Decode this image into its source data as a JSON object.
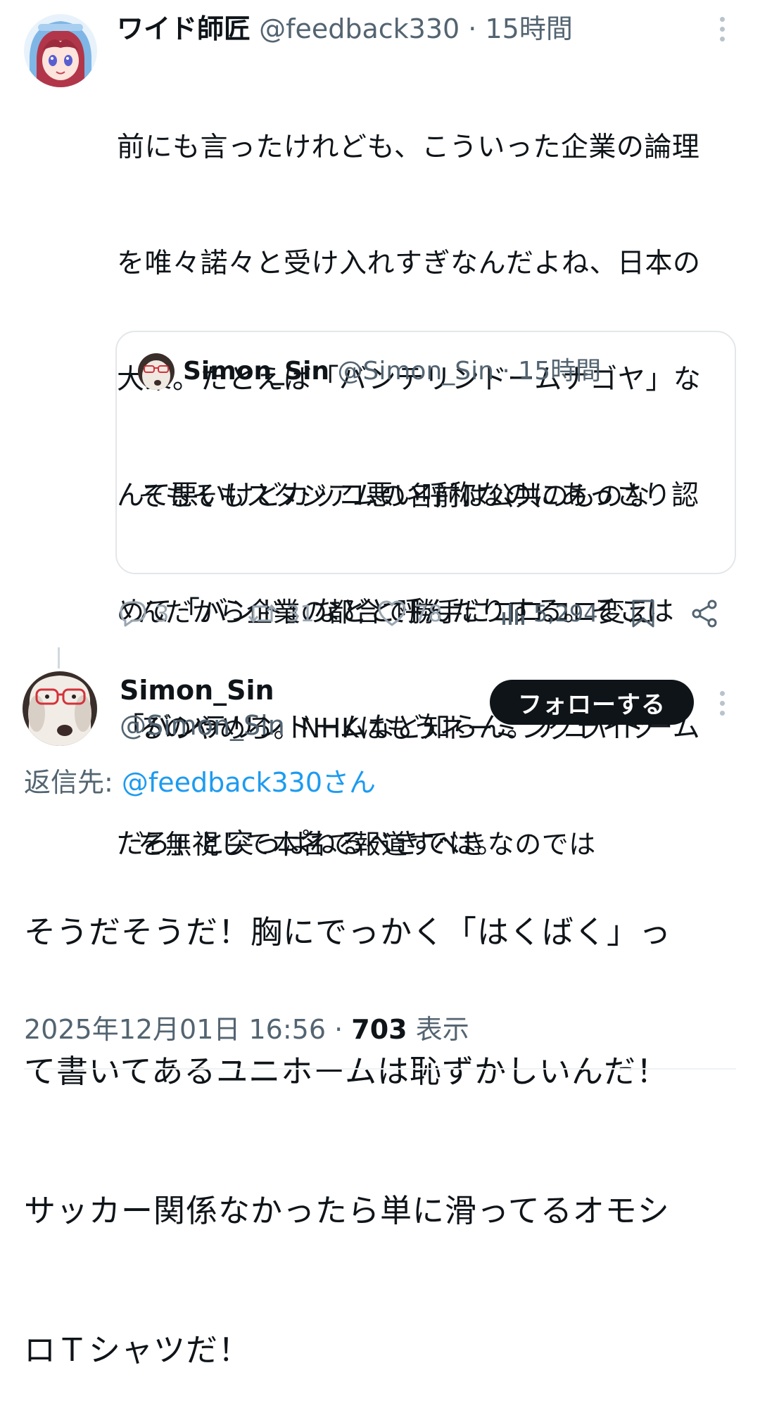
{
  "tweet1": {
    "author_name": "ワイド師匠",
    "handle": "@feedback330",
    "separator": "·",
    "time": "15時間",
    "body_lines": [
      "前にも言ったけれども、こういった企業の論理",
      "を唯々諾々と受け入れすぎなんだよね、日本の",
      "大衆。たとえば「バンテリンドームナゴヤ」な",
      "んて悪いけどカッコ悪い呼称なのにあっさり認",
      "めて「バンド」などと呼んだりする。そこは",
      "「バンテリンドームなど知らん。ナゴヤドーム",
      "だろ」と突っぱねるべきでは。"
    ],
    "quote": {
      "author_name": "Simon_Sin",
      "handle": "@Simon_Sin",
      "separator": "·",
      "time": "15時間",
      "body_lines": [
        "そもそもスタジアムの名前は公共のものな",
        "んだから企業の都合で勝手にコロコロ変え",
        "るのやめろ。NHKはもうネーミングライツ",
        "を無視して本名で報道すべきなのでは"
      ]
    },
    "actions": {
      "replies": "3",
      "reposts": "31",
      "likes": "78",
      "views": "5,294"
    }
  },
  "tweet2": {
    "author_name": "Simon_Sin",
    "handle": "@Simon_Sin",
    "follow_label": "フォローする",
    "reply_to_label": "返信先:",
    "reply_to_link": "@feedback330さん",
    "body_lines": [
      "そうだそうだ！胸にでっかく「はくばく」っ",
      "て書いてあるユニホームは恥ずかしいんだ！",
      "サッカー関係なかったら単に滑ってるオモシ",
      "ロＴシャツだ！"
    ],
    "timestamp": "2025年12月01日 16:56",
    "separator": "·",
    "view_count": "703",
    "view_label": "表示"
  },
  "icons": {
    "more": "more-vertical-icon",
    "reply": "reply-bubble-icon",
    "repost": "repost-icon",
    "like": "heart-icon",
    "views": "bar-chart-icon",
    "bookmark": "bookmark-icon",
    "share": "share-icon"
  },
  "colors": {
    "text": "#0f1419",
    "muted": "#536471",
    "action_gray": "#9aa6b1",
    "link": "#1d9bf0",
    "follow_bg": "#0f1419",
    "border": "#e3e7ea"
  }
}
